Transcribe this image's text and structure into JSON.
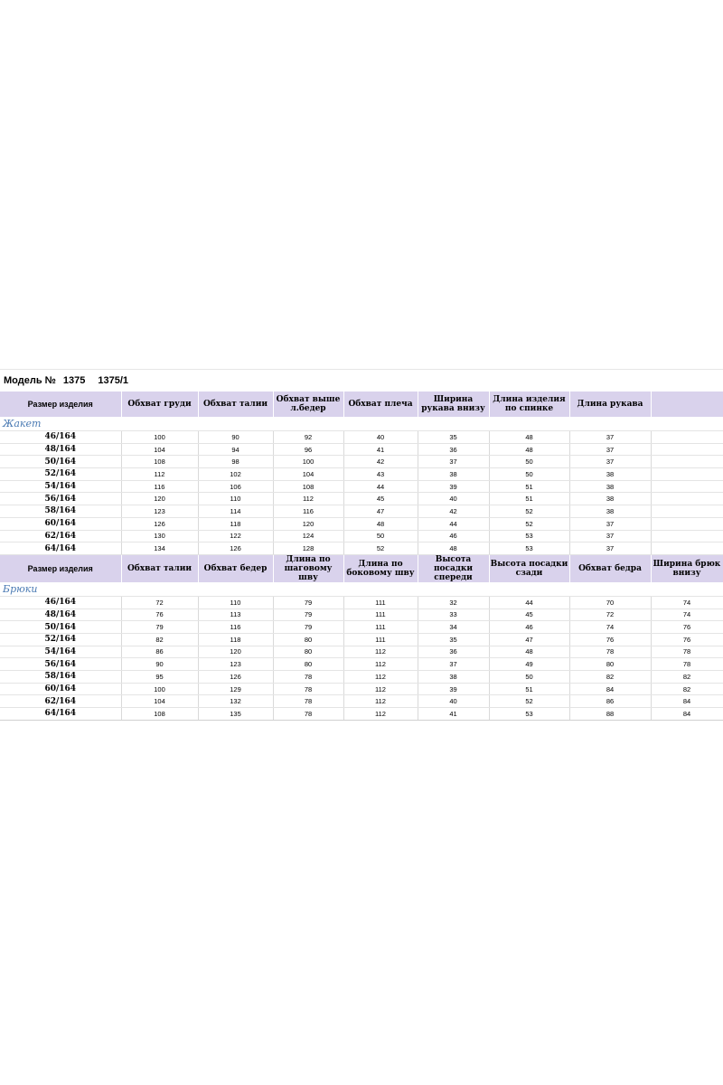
{
  "model": {
    "label": "Модель №",
    "num1": "1375",
    "num2": "1375/1"
  },
  "jacket": {
    "section_title": "Жакет",
    "headers": [
      "Размер изделия",
      "Обхват груди",
      "Обхват талии",
      "Обхват выше л.бедер",
      "Обхват плеча",
      "Ширина рукава внизу",
      "Длина изделия по спинке",
      "Длина рукава",
      ""
    ],
    "rows": [
      [
        "46/164",
        "100",
        "90",
        "92",
        "40",
        "35",
        "48",
        "37"
      ],
      [
        "48/164",
        "104",
        "94",
        "96",
        "41",
        "36",
        "48",
        "37"
      ],
      [
        "50/164",
        "108",
        "98",
        "100",
        "42",
        "37",
        "50",
        "37"
      ],
      [
        "52/164",
        "112",
        "102",
        "104",
        "43",
        "38",
        "50",
        "38"
      ],
      [
        "54/164",
        "116",
        "106",
        "108",
        "44",
        "39",
        "51",
        "38"
      ],
      [
        "56/164",
        "120",
        "110",
        "112",
        "45",
        "40",
        "51",
        "38"
      ],
      [
        "58/164",
        "123",
        "114",
        "116",
        "47",
        "42",
        "52",
        "38"
      ],
      [
        "60/164",
        "126",
        "118",
        "120",
        "48",
        "44",
        "52",
        "37"
      ],
      [
        "62/164",
        "130",
        "122",
        "124",
        "50",
        "46",
        "53",
        "37"
      ],
      [
        "64/164",
        "134",
        "126",
        "128",
        "52",
        "48",
        "53",
        "37"
      ]
    ]
  },
  "trousers": {
    "section_title": "Брюки",
    "headers": [
      "Размер изделия",
      "Обхват талии",
      "Обхват бедер",
      "Длина по шаговому шву",
      "Длина по боковому шву",
      "Высота посадки спереди",
      "Высота посадки сзади",
      "Обхват бедра",
      "Ширина брюк внизу"
    ],
    "rows": [
      [
        "46/164",
        "72",
        "110",
        "79",
        "111",
        "32",
        "44",
        "70",
        "74"
      ],
      [
        "48/164",
        "76",
        "113",
        "79",
        "111",
        "33",
        "45",
        "72",
        "74"
      ],
      [
        "50/164",
        "79",
        "116",
        "79",
        "111",
        "34",
        "46",
        "74",
        "76"
      ],
      [
        "52/164",
        "82",
        "118",
        "80",
        "111",
        "35",
        "47",
        "76",
        "76"
      ],
      [
        "54/164",
        "86",
        "120",
        "80",
        "112",
        "36",
        "48",
        "78",
        "78"
      ],
      [
        "56/164",
        "90",
        "123",
        "80",
        "112",
        "37",
        "49",
        "80",
        "78"
      ],
      [
        "58/164",
        "95",
        "126",
        "78",
        "112",
        "38",
        "50",
        "82",
        "82"
      ],
      [
        "60/164",
        "100",
        "129",
        "78",
        "112",
        "39",
        "51",
        "84",
        "82"
      ],
      [
        "62/164",
        "104",
        "132",
        "78",
        "112",
        "40",
        "52",
        "86",
        "84"
      ],
      [
        "64/164",
        "108",
        "135",
        "78",
        "112",
        "41",
        "53",
        "88",
        "84"
      ]
    ]
  }
}
